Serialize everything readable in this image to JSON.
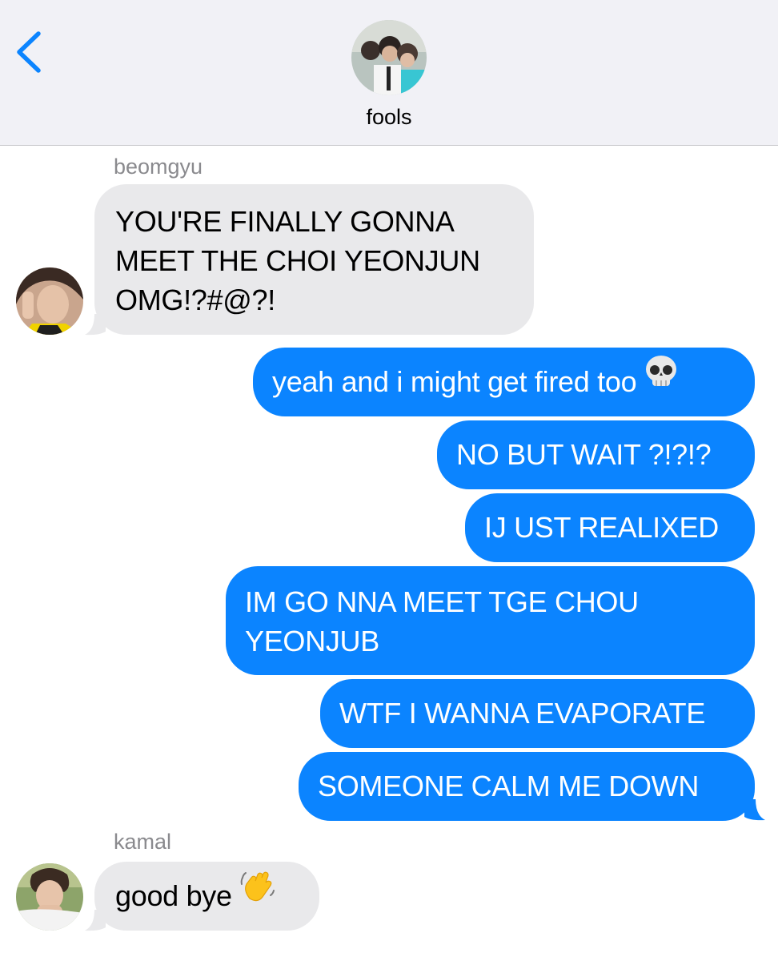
{
  "header": {
    "back_icon": "chevron-left-icon",
    "group_name": "fools",
    "group_avatar": "group-photo"
  },
  "colors": {
    "header_bg": "#f1f1f6",
    "incoming_bubble": "#e9e9eb",
    "outgoing_bubble": "#0b84ff",
    "accent": "#0b84ff",
    "sender_name": "#8a8a8e"
  },
  "messages": {
    "m1": {
      "sender": "beomgyu",
      "line1": "YOU'RE FINALLY GONNA",
      "line2": "MEET THE CHOI YEONJUN",
      "line3": "OMG!?#@?!"
    },
    "m2": {
      "text": "yeah and i might get fired too",
      "emoji": "skull-emoji"
    },
    "m3": {
      "text": "NO BUT WAIT ?!?!?"
    },
    "m4": {
      "text": "IJ UST REALIXED"
    },
    "m5": {
      "line1": "IM GO NNA MEET TGE CHOU",
      "line2": "YEONJUB"
    },
    "m6": {
      "text": "WTF I WANNA EVAPORATE"
    },
    "m7": {
      "text": "SOMEONE CALM ME DOWN"
    },
    "m8": {
      "sender": "kamal",
      "text": "good bye",
      "emoji": "waving-hand-emoji"
    }
  }
}
